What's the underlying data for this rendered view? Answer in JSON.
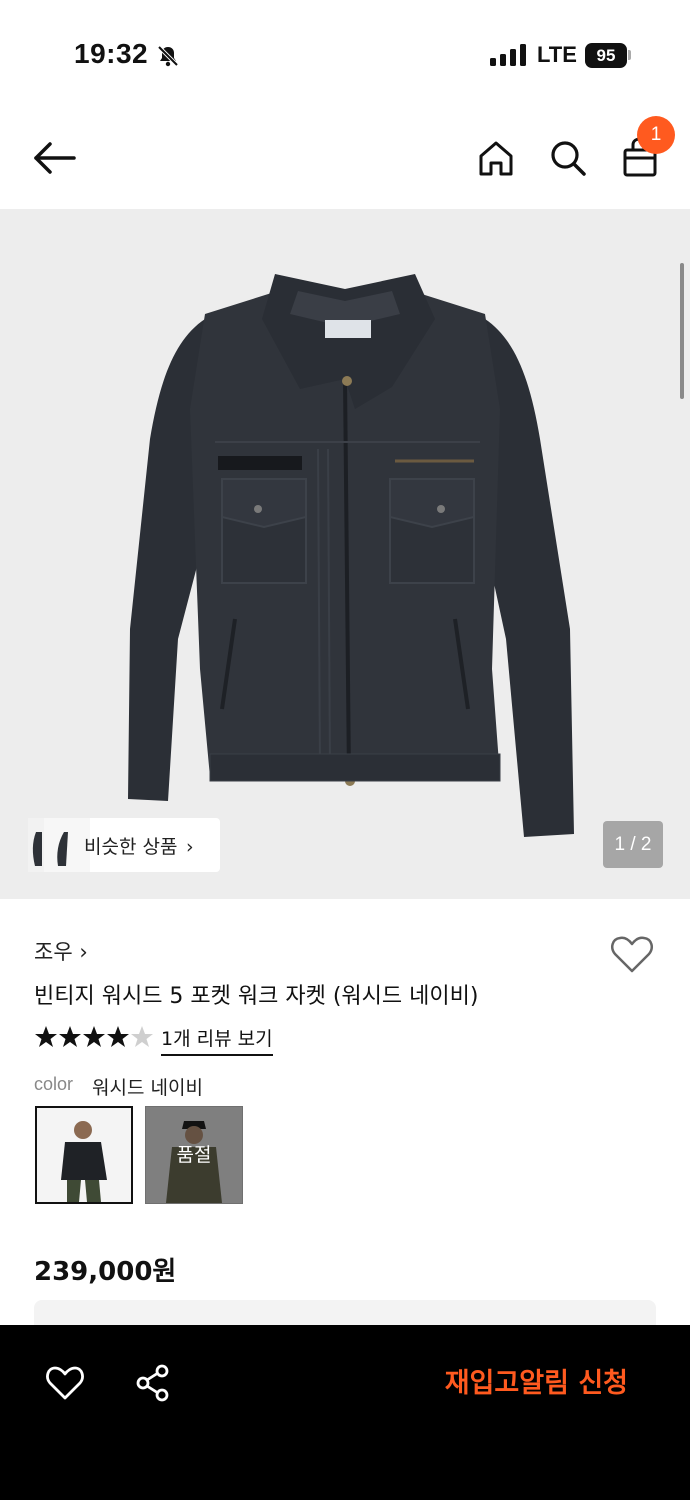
{
  "status_bar": {
    "time": "19:32",
    "network": "LTE",
    "battery": "95"
  },
  "header": {
    "cart_count": "1"
  },
  "gallery": {
    "similar_label": "비슷한 상품",
    "similar_chevron": "›",
    "page_indicator": "1 / 2"
  },
  "product": {
    "brand": "조우 ›",
    "title": "빈티지 워시드 5 포켓 워크 자켓 (워시드 네이비)",
    "rating": 4,
    "rating_max": 5,
    "review_link": "1개 리뷰 보기",
    "color_label": "color",
    "color_value": "워시드 네이비",
    "swatches": [
      {
        "name": "워시드 네이비",
        "sold_out": false
      },
      {
        "name": "",
        "sold_out": true
      }
    ],
    "soldout_label": "품절",
    "price": "239,000원"
  },
  "bottom_bar": {
    "restock_label": "재입고알림 신청"
  },
  "colors": {
    "accent": "#ff5a1f",
    "gallery_bg": "#ededed",
    "jacket": "#2f333a"
  }
}
